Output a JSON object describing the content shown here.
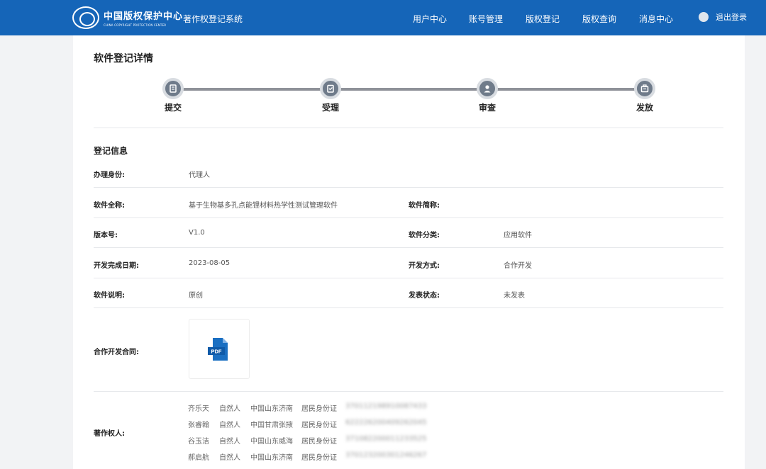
{
  "header": {
    "logo_cn": "中国版权保护中心",
    "logo_en": "CHINA COPYRIGHT PROTECTION CENTER",
    "system_name": "著作权登记系统",
    "nav": [
      "用户中心",
      "账号管理",
      "版权登记",
      "版权查询",
      "消息中心"
    ],
    "logout": "退出登录"
  },
  "page": {
    "title": "软件登记详情"
  },
  "steps": [
    "提交",
    "受理",
    "审查",
    "发放"
  ],
  "section": {
    "title": "登记信息"
  },
  "fields": {
    "identity": {
      "label": "办理身份:",
      "value": "代理人"
    },
    "full_name": {
      "label": "软件全称:",
      "value": "基于生物基多孔点能锂材料热学性测试管理软件"
    },
    "short_name": {
      "label": "软件简称:",
      "value": ""
    },
    "version": {
      "label": "版本号:",
      "value": "V1.0"
    },
    "category": {
      "label": "软件分类:",
      "value": "应用软件"
    },
    "complete_date": {
      "label": "开发完成日期:",
      "value": "2023-08-05"
    },
    "dev_mode": {
      "label": "开发方式:",
      "value": "合作开发"
    },
    "description": {
      "label": "软件说明:",
      "value": "原创"
    },
    "publish_status": {
      "label": "发表状态:",
      "value": "未发表"
    },
    "contract": {
      "label": "合作开发合同:",
      "file_icon": "pdf-file-icon",
      "file_text": "PDF"
    },
    "owners_label": "著作权人:"
  },
  "owners": [
    {
      "name": "齐乐天",
      "type": "自然人",
      "region": "中国山东济南",
      "id_type": "居民身份证",
      "id_number": "370112198910087433"
    },
    {
      "name": "张睿翰",
      "type": "自然人",
      "region": "中国甘肃张掖",
      "id_type": "居民身份证",
      "id_number": "622226200409262045"
    },
    {
      "name": "谷玉洁",
      "type": "自然人",
      "region": "中国山东威海",
      "id_type": "居民身份证",
      "id_number": "371082200011233525"
    },
    {
      "name": "郝启航",
      "type": "自然人",
      "region": "中国山东济南",
      "id_type": "居民身份证",
      "id_number": "370123200301246267"
    }
  ],
  "colors": {
    "header_bg": "#1565b8",
    "step_circle": "#6f7b8a",
    "pdf_icon": "#1a6fc2"
  }
}
